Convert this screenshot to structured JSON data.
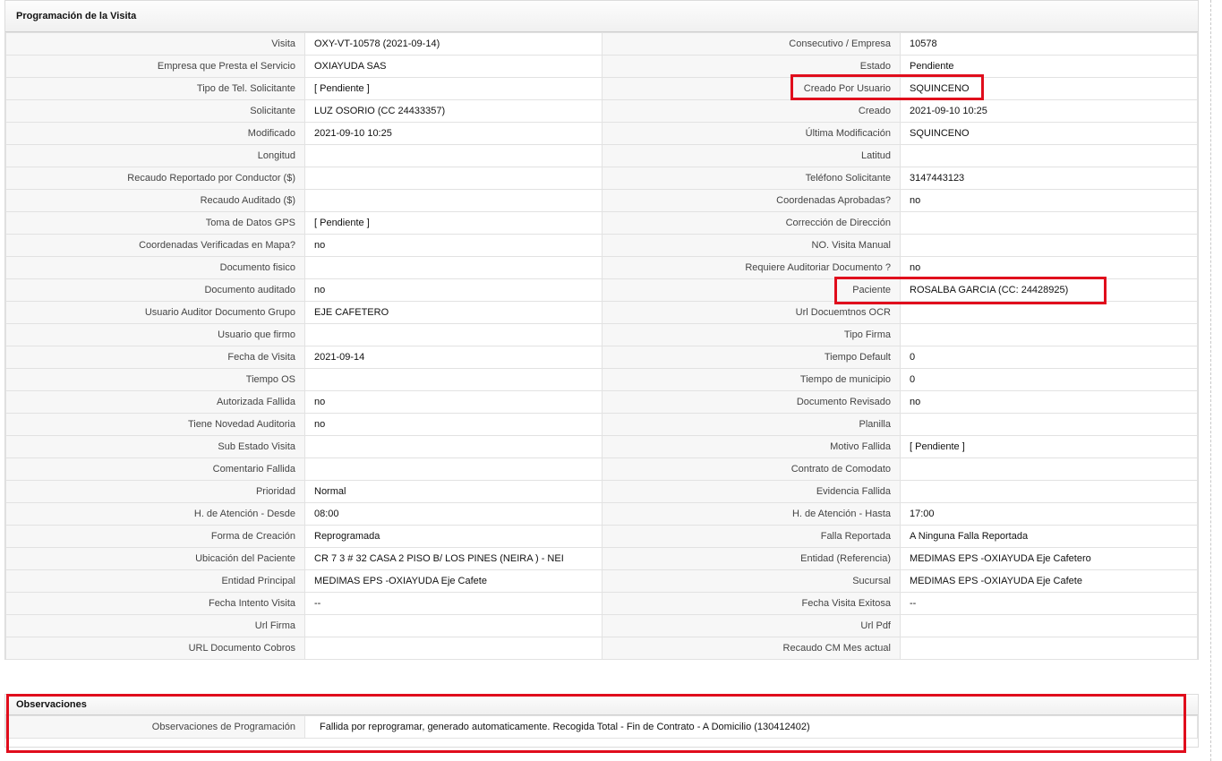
{
  "programacion": {
    "title": "Programación de la Visita",
    "rows": [
      {
        "l1": "Visita",
        "v1": "OXY-VT-10578 (2021-09-14)",
        "l2": "Consecutivo / Empresa",
        "v2": "10578"
      },
      {
        "l1": "Empresa que Presta el Servicio",
        "v1": "OXIAYUDA SAS",
        "l2": "Estado",
        "v2": "Pendiente"
      },
      {
        "l1": "Tipo de Tel. Solicitante",
        "v1": "[ Pendiente ]",
        "l2": "Creado Por Usuario",
        "v2": "SQUINCENO"
      },
      {
        "l1": "Solicitante",
        "v1": "LUZ OSORIO (CC 24433357)",
        "l2": "Creado",
        "v2": "2021-09-10 10:25"
      },
      {
        "l1": "Modificado",
        "v1": "2021-09-10 10:25",
        "l2": "Última Modificación",
        "v2": " SQUINCENO"
      },
      {
        "l1": "Longitud",
        "v1": "",
        "l2": "Latitud",
        "v2": ""
      },
      {
        "l1": "Recaudo Reportado por Conductor ($)",
        "v1": "",
        "l2": "Teléfono Solicitante",
        "v2": "3147443123"
      },
      {
        "l1": "Recaudo Auditado ($)",
        "v1": "",
        "l2": "Coordenadas Aprobadas?",
        "v2": " no"
      },
      {
        "l1": "Toma de Datos GPS",
        "v1": "[ Pendiente ]",
        "l2": "Corrección de Dirección",
        "v2": ""
      },
      {
        "l1": "Coordenadas Verificadas en Mapa?",
        "v1": " no",
        "l2": "NO. Visita Manual",
        "v2": ""
      },
      {
        "l1": "Documento fisico",
        "v1": "",
        "l2": "Requiere Auditoriar Documento ?",
        "v2": " no"
      },
      {
        "l1": "Documento auditado",
        "v1": " no",
        "l2": "Paciente",
        "v2": "ROSALBA GARCIA (CC: 24428925)"
      },
      {
        "l1": "Usuario Auditor Documento Grupo",
        "v1": "EJE CAFETERO",
        "l2": "Url Docuemtnos OCR",
        "v2": ""
      },
      {
        "l1": "Usuario que firmo",
        "v1": "",
        "l2": "Tipo Firma",
        "v2": ""
      },
      {
        "l1": "Fecha de Visita",
        "v1": " 2021-09-14",
        "l2": "Tiempo Default",
        "v2": "0"
      },
      {
        "l1": "Tiempo OS",
        "v1": "",
        "l2": "Tiempo de municipio",
        "v2": "0"
      },
      {
        "l1": "Autorizada Fallida",
        "v1": " no",
        "l2": "Documento Revisado",
        "v2": " no"
      },
      {
        "l1": "Tiene Novedad Auditoria",
        "v1": " no",
        "l2": "Planilla",
        "v2": ""
      },
      {
        "l1": "Sub Estado Visita",
        "v1": "",
        "l2": "Motivo Fallida",
        "v2": "[ Pendiente ]"
      },
      {
        "l1": "Comentario Fallida",
        "v1": "",
        "l2": "Contrato de Comodato",
        "v2": ""
      },
      {
        "l1": "Prioridad",
        "v1": "Normal",
        "l2": "Evidencia Fallida",
        "v2": ""
      },
      {
        "l1": "H. de Atención - Desde",
        "v1": "08:00",
        "l2": "H. de Atención - Hasta",
        "v2": "17:00"
      },
      {
        "l1": "Forma de Creación",
        "v1": "Reprogramada",
        "l2": "Falla Reportada",
        "v2": "A Ninguna Falla Reportada"
      },
      {
        "l1": "Ubicación del Paciente",
        "v1": "CR 7 3 # 32 CASA 2 PISO B/ LOS PINES (NEIRA ) - NEI",
        "l2": "Entidad (Referencia)",
        "v2": "MEDIMAS EPS -OXIAYUDA Eje Cafetero"
      },
      {
        "l1": "Entidad Principal",
        "v1": "MEDIMAS EPS -OXIAYUDA Eje Cafete",
        "l2": "Sucursal",
        "v2": "MEDIMAS EPS -OXIAYUDA Eje Cafete"
      },
      {
        "l1": "Fecha Intento Visita",
        "v1": " --",
        "l2": "Fecha Visita Exitosa",
        "v2": " --"
      },
      {
        "l1": "Url Firma",
        "v1": "",
        "l2": "Url Pdf",
        "v2": ""
      },
      {
        "l1": "URL Documento Cobros",
        "v1": "",
        "l2": "Recaudo CM Mes actual",
        "v2": ""
      }
    ]
  },
  "observaciones": {
    "title": "Observaciones",
    "label": "Observaciones de Programación",
    "value": "Fallida por reprogramar, generado automaticamente. Recogida Total - Fin de Contrato - A Domicilio (130412402)"
  },
  "colors": {
    "highlight": "#e00d1c"
  }
}
